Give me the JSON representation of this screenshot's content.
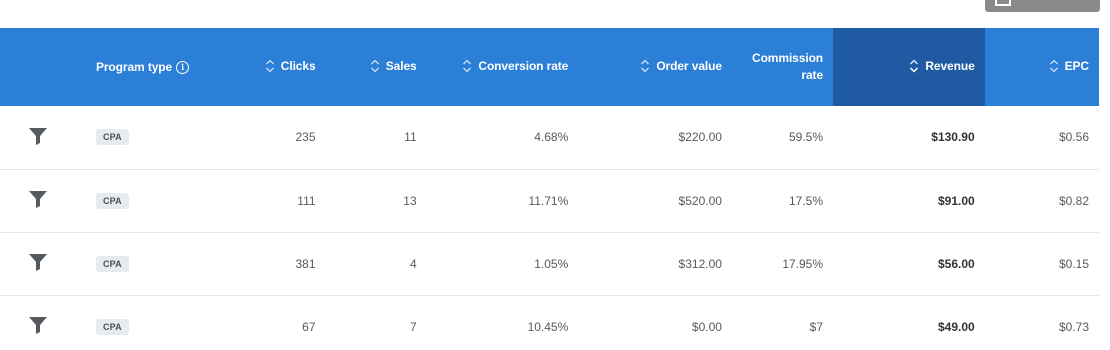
{
  "colors": {
    "header_bg": "#2b7fd6",
    "header_active_bg": "#1f5aa3",
    "badge_bg": "#e6ebf0",
    "row_border": "#e4e7eb",
    "filter_icon": "#555a60"
  },
  "table": {
    "headers": {
      "program_type": "Program type",
      "clicks": "Clicks",
      "sales": "Sales",
      "conversion_rate": "Conversion rate",
      "order_value": "Order value",
      "commission_rate_line1": "Commission",
      "commission_rate_line2": "rate",
      "revenue": "Revenue",
      "epc": "EPC"
    },
    "sorted_column": "revenue",
    "rows": [
      {
        "program_type": "CPA",
        "clicks": "235",
        "sales": "11",
        "conversion_rate": "4.68%",
        "order_value": "$220.00",
        "commission_rate": "59.5%",
        "revenue": "$130.90",
        "epc": "$0.56"
      },
      {
        "program_type": "CPA",
        "clicks": "111",
        "sales": "13",
        "conversion_rate": "11.71%",
        "order_value": "$520.00",
        "commission_rate": "17.5%",
        "revenue": "$91.00",
        "epc": "$0.82"
      },
      {
        "program_type": "CPA",
        "clicks": "381",
        "sales": "4",
        "conversion_rate": "1.05%",
        "order_value": "$312.00",
        "commission_rate": "17.95%",
        "revenue": "$56.00",
        "epc": "$0.15"
      },
      {
        "program_type": "CPA",
        "clicks": "67",
        "sales": "7",
        "conversion_rate": "10.45%",
        "order_value": "$0.00",
        "commission_rate": "$7",
        "revenue": "$49.00",
        "epc": "$0.73"
      }
    ]
  }
}
